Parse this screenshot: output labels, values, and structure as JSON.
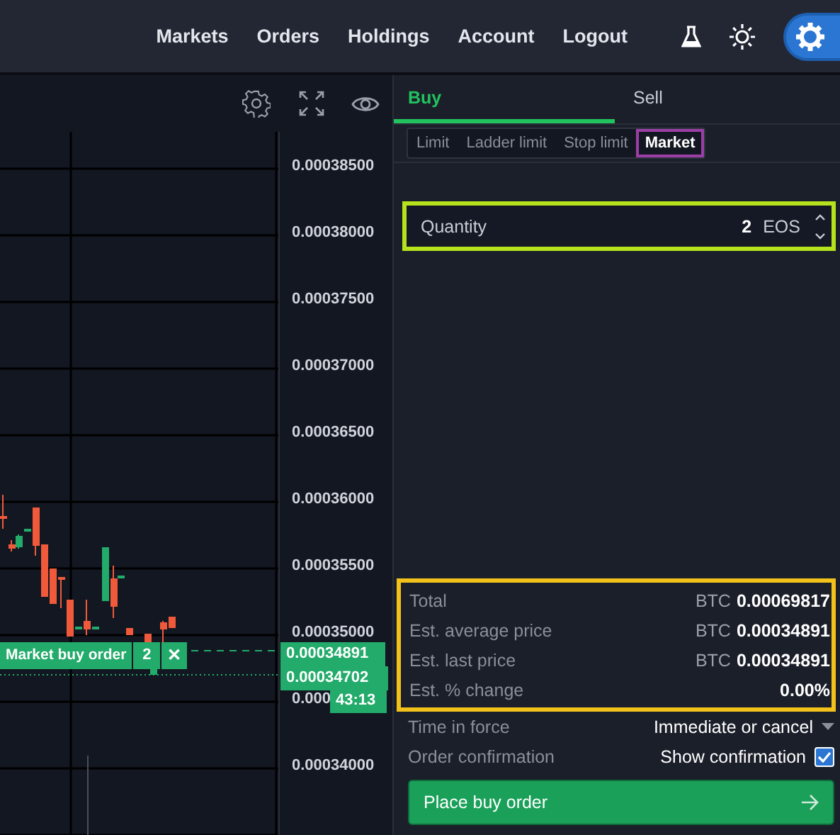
{
  "nav": {
    "links": [
      "Markets",
      "Orders",
      "Holdings",
      "Account",
      "Logout"
    ]
  },
  "chart": {
    "price_axis": [
      "0.00038500",
      "0.00038000",
      "0.00037500",
      "0.00037000",
      "0.00036500",
      "0.00036000",
      "0.00035500",
      "0.00035000",
      "0.000",
      "0.00034000"
    ],
    "order_line": {
      "label": "Market buy order",
      "quantity": "2",
      "cancel": "✕"
    },
    "price_tags": [
      {
        "text": "0.00034891",
        "kind": "order"
      },
      {
        "text": "0.00034702",
        "kind": "last"
      },
      {
        "text": "43:13",
        "kind": "countdown"
      }
    ]
  },
  "order_panel": {
    "tabs": [
      {
        "label": "Buy",
        "selected": true
      },
      {
        "label": "Sell",
        "selected": false
      }
    ],
    "order_types": [
      {
        "label": "Limit",
        "selected": false
      },
      {
        "label": "Ladder limit",
        "selected": false
      },
      {
        "label": "Stop limit",
        "selected": false
      },
      {
        "label": "Market",
        "selected": true
      }
    ],
    "quantity": {
      "label": "Quantity",
      "value": "2",
      "unit": "EOS"
    },
    "summary": [
      {
        "label": "Total",
        "currency": "BTC",
        "value": "0.00069817"
      },
      {
        "label": "Est. average price",
        "currency": "BTC",
        "value": "0.00034891"
      },
      {
        "label": "Est. last price",
        "currency": "BTC",
        "value": "0.00034891"
      },
      {
        "label": "Est. % change",
        "value": "0.00%"
      }
    ],
    "time_in_force": {
      "label": "Time in force",
      "value": "Immediate or cancel"
    },
    "confirmation": {
      "label": "Order confirmation",
      "option": "Show confirmation",
      "checked": true
    },
    "submit": "Place buy order"
  }
}
